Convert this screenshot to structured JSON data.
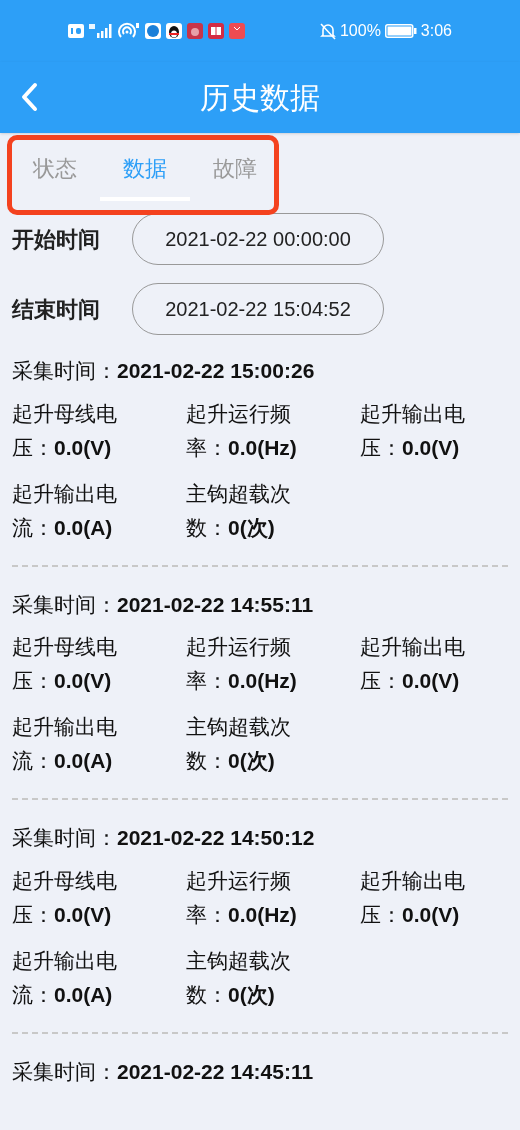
{
  "status_bar": {
    "battery": "100%",
    "time": "3:06"
  },
  "app_bar": {
    "title": "历史数据"
  },
  "tabs": [
    {
      "label": "状态",
      "selected": false
    },
    {
      "label": "数据",
      "selected": true
    },
    {
      "label": "故障",
      "selected": false
    }
  ],
  "filters": [
    {
      "label": "开始时间",
      "value": "2021-02-22 00:00:00"
    },
    {
      "label": "结束时间",
      "value": "2021-02-22 15:04:52"
    }
  ],
  "records": [
    {
      "time_label": "采集时间：",
      "time": "2021-02-22 15:00:26",
      "fields": [
        "起升母线电压：**0.0(V)**",
        "起升运行频率：**0.0(Hz)**",
        "起升输出电压：**0.0(V)**",
        "起升输出电流：**0.0(A)**",
        "主钩超载次数：**0(次)**"
      ]
    },
    {
      "time_label": "采集时间：",
      "time": "2021-02-22 14:55:11",
      "fields": [
        "起升母线电压：**0.0(V)**",
        "起升运行频率：**0.0(Hz)**",
        "起升输出电压：**0.0(V)**",
        "起升输出电流：**0.0(A)**",
        "主钩超载次数：**0(次)**"
      ]
    },
    {
      "time_label": "采集时间：",
      "time": "2021-02-22 14:50:12",
      "fields": [
        "起升母线电压：**0.0(V)**",
        "起升运行频率：**0.0(Hz)**",
        "起升输出电压：**0.0(V)**",
        "起升输出电流：**0.0(A)**",
        "主钩超载次数：**0(次)**"
      ]
    },
    {
      "time_label": "采集时间：",
      "time": "2021-02-22 14:45:11"
    }
  ]
}
